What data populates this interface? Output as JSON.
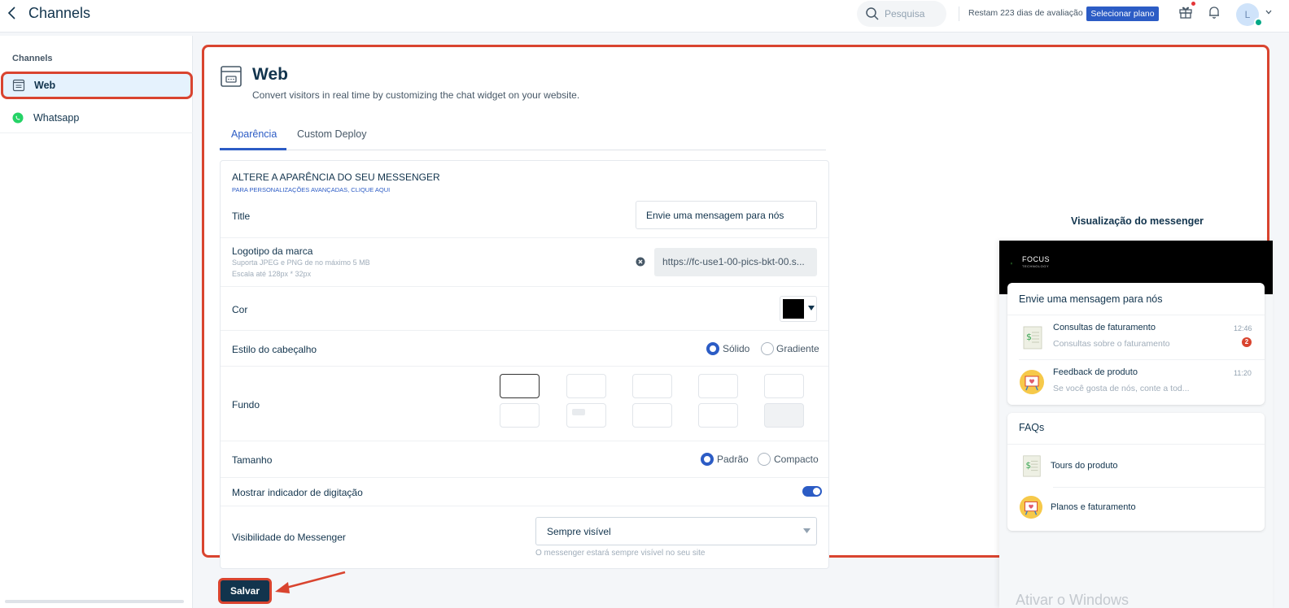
{
  "topbar": {
    "title": "Channels",
    "search_placeholder": "Pesquisa",
    "trial_text": "Restam 223 dias de avaliação",
    "plan_button": "Selecionar plano",
    "avatar_initial": "L"
  },
  "sidebar": {
    "heading": "Channels",
    "items": [
      {
        "label": "Web",
        "icon": "web-widget-icon",
        "active": true
      },
      {
        "label": "Whatsapp",
        "icon": "whatsapp-icon",
        "active": false
      }
    ]
  },
  "page": {
    "title": "Web",
    "description": "Convert visitors in real time by customizing the chat widget on your website.",
    "tabs": [
      {
        "label": "Aparência",
        "active": true
      },
      {
        "label": "Custom Deploy",
        "active": false
      }
    ]
  },
  "form": {
    "heading": "ALTERE A APARÊNCIA DO SEU MESSENGER",
    "sublink": "PARA PERSONALIZAÇÕES AVANÇADAS, CLIQUE AQUI",
    "title_label": "Title",
    "title_value": "Envie uma mensagem para nós",
    "logo_label": "Logotipo da marca",
    "logo_hint_1": "Suporta JPEG e PNG de no máximo 5 MB",
    "logo_hint_2": "Escala até 128px * 32px",
    "logo_url": "https://fc-use1-00-pics-bkt-00.s...",
    "color_label": "Cor",
    "color_value": "#000000",
    "header_style_label": "Estilo do cabeçalho",
    "header_style_options": [
      "Sólido",
      "Gradiente"
    ],
    "header_style_selected": "Sólido",
    "background_label": "Fundo",
    "size_label": "Tamanho",
    "size_options": [
      "Padrão",
      "Compacto"
    ],
    "size_selected": "Padrão",
    "typing_label": "Mostrar indicador de digitação",
    "typing_enabled": true,
    "visibility_label": "Visibilidade do Messenger",
    "visibility_value": "Sempre visível",
    "visibility_hint": "O messenger estará sempre visível no seu site"
  },
  "preview": {
    "title": "Visualização do messenger",
    "brand_name": "FOCUS",
    "brand_sub": "TECHNOLOGY",
    "conversation_title": "Envie uma mensagem para nós",
    "conversations": [
      {
        "name": "Consultas de faturamento",
        "preview": "Consultas sobre o faturamento",
        "time": "12:46",
        "badge": "2"
      },
      {
        "name": "Feedback de produto",
        "preview": "Se você gosta de nós, conte a tod...",
        "time": "11:20",
        "badge": ""
      }
    ],
    "faq_title": "FAQs",
    "faqs": [
      {
        "label": "Tours do produto"
      },
      {
        "label": "Planos e faturamento"
      }
    ],
    "watermark": "Ativar o Windows"
  },
  "actions": {
    "save_label": "Salvar"
  },
  "colors": {
    "accent": "#2c5cc5",
    "dark": "#12344d",
    "highlight": "#d9442f"
  }
}
